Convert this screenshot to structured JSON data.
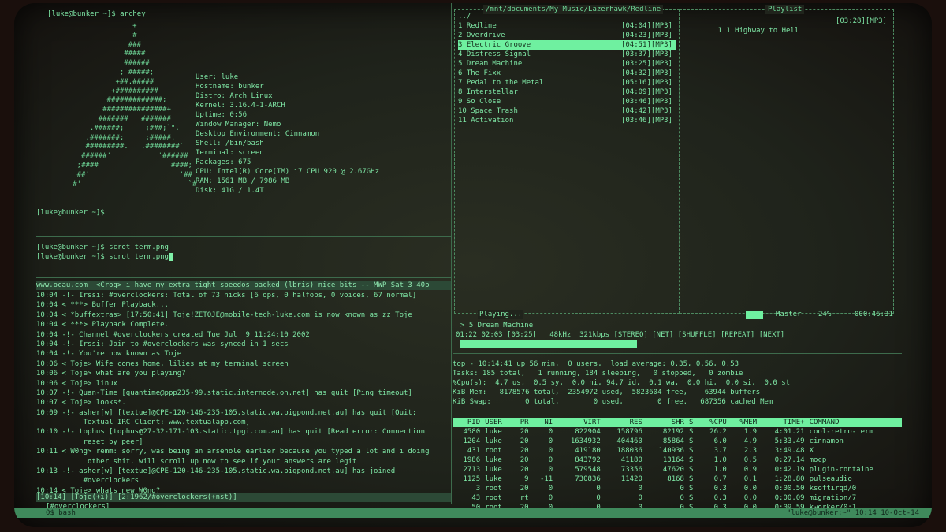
{
  "archey": {
    "prompt1": "[luke@bunker ~]$ archey",
    "logo_lines": [
      "                 +",
      "                 #",
      "                ###",
      "               #####",
      "               ######",
      "              ; #####;",
      "             +##.#####",
      "            +##########",
      "           #############;",
      "          ###############+",
      "         #######   #######",
      "       .######;     ;###;`\".",
      "      .#######;     ;#####.",
      "      #########.   .########`",
      "     ######'           '######",
      "    ;####                 ####;",
      "    ##'                     '##",
      "   #'                         `#"
    ],
    "info": [
      "User: luke",
      "Hostname: bunker",
      "Distro: Arch Linux",
      "Kernel: 3.16.4-1-ARCH",
      "Uptime: 0:56",
      "Window Manager: Nemo",
      "Desktop Environment: Cinnamon",
      "Shell: /bin/bash",
      "Terminal: screen",
      "Packages: 675",
      "CPU: Intel(R) Core(TM) i7 CPU 920 @ 2.67GHz",
      "RAM: 1561 MB / 7986 MB",
      "Disk: 41G / 1.4T"
    ],
    "prompt2": "[luke@bunker ~]$"
  },
  "scrot": {
    "line1": "[luke@bunker ~]$ scrot term.png",
    "line2": "[luke@bunker ~]$ scrot term.png"
  },
  "player": {
    "dir_title": "/mnt/documents/My Music/Lazerhawk/Redline",
    "parent": "../",
    "tracks": [
      {
        "name": "1 Redline",
        "dur": "[04:04][MP3]"
      },
      {
        "name": "2 Overdrive",
        "dur": "[04:23][MP3]"
      },
      {
        "name": "3 Electric Groove",
        "dur": "[04:51][MP3]"
      },
      {
        "name": "4 Distress Signal",
        "dur": "[03:37][MP3]"
      },
      {
        "name": "5 Dream Machine",
        "dur": "[03:25][MP3]"
      },
      {
        "name": "6 The Fixx",
        "dur": "[04:32][MP3]"
      },
      {
        "name": "7 Pedal to the Metal",
        "dur": "[05:16][MP3]"
      },
      {
        "name": "8 Interstellar",
        "dur": "[04:09][MP3]"
      },
      {
        "name": "9 So Close",
        "dur": "[03:46][MP3]"
      },
      {
        "name": "10 Space Trash",
        "dur": "[04:42][MP3]"
      },
      {
        "name": "11 Activation",
        "dur": "[03:46][MP3]"
      }
    ],
    "selected_index": 2,
    "playlist_title": "Playlist",
    "playlist_item": "1 1 Highway to Hell",
    "playlist_dur": "[03:28][MP3]",
    "playing_label": "Playing...",
    "now_playing": "> 5 Dream Machine",
    "status_line": "01:22 02:03 [03:25]   48kHz  321kbps [STEREO] [NET] [SHUFFLE] [REPEAT] [NEXT]",
    "progress": 0.4,
    "master_label": "Master",
    "volume": "24%",
    "total_time": "000:46:31"
  },
  "irc": {
    "topic": "www.ocau.com  <Crog> i have my extra tight speedos packed (lbris) nice bits -- MWP Sat 3 40p",
    "lines": [
      "10:04 -!- Irssi: #overclockers: Total of 73 nicks [6 ops, 0 halfops, 0 voices, 67 normal]",
      "10:04 < ***> Buffer Playback...",
      "10:04 < *buffextras> [17:50:41] Toje!ZETOJE@mobile-tech-luke.com is now known as zz_Toje",
      "10:04 < ***> Playback Complete.",
      "10:04 -!- Channel #overclockers created Tue Jul  9 11:24:10 2002",
      "10:04 -!- Irssi: Join to #overclockers was synced in 1 secs",
      "10:04 -!- You're now known as Toje",
      "10:06 < Toje> Wife comes home, lilies at my terminal screen",
      "10:06 < Toje> what are you playing?",
      "10:06 < Toje> linux",
      "10:07 -!- Quan-Time [quantime@ppp235-99.static.internode.on.net] has quit [Ping timeout]",
      "10:07 < Toje> looks*.",
      "10:09 -!- asher[w] [textue]@CPE-120-146-235-105.static.wa.bigpond.net.au] has quit [Quit:",
      "           Textual IRC Client: www.textualapp.com]",
      "10:10 -!- tophus [tophus@27-32-171-103.static.tpgi.com.au] has quit [Read error: Connection",
      "           reset by peer]",
      "10:11 < W0ng> remm: sorry, was being an arsehole earlier because you typed a lot and i doing",
      "            other shit. will scroll up now to see if your answers are legit",
      "10:13 -!- asher[w] [textue]@CPE-120-146-235-105.static.wa.bigpond.net.au] has joined",
      "           #overclockers",
      "10:14 < Toje> whats new W0ng?"
    ],
    "status1": "[10:14] [Toje(+i)] [2:1962/#overclockers(+nst)]",
    "channel": "[#overclockers]",
    "tab_bar": "0$ bash",
    "bottom_right": "\"luke@bunker:~\" 10:14 10-Oct-14"
  },
  "htop": {
    "summary": [
      "top - 10:14:41 up 56 min,  0 users,  load average: 0.35, 0.56, 0.53",
      "Tasks: 185 total,   1 running, 184 sleeping,   0 stopped,   0 zombie",
      "%Cpu(s):  4.7 us,  0.5 sy,  0.0 ni, 94.7 id,  0.1 wa,  0.0 hi,  0.0 si,  0.0 st",
      "KiB Mem:   8178576 total,  2354972 used,  5823604 free,    63944 buffers",
      "KiB Swap:        0 total,        0 used,        0 free.   687356 cached Mem"
    ],
    "columns": [
      "PID",
      "USER",
      "PR",
      "NI",
      "VIRT",
      "RES",
      "SHR",
      "S",
      "%CPU",
      "%MEM",
      "TIME+",
      "COMMAND"
    ],
    "rows": [
      [
        "4580",
        "luke",
        "20",
        "0",
        "822904",
        "158796",
        "82192",
        "S",
        "26.2",
        "1.9",
        "4:01.21",
        "cool-retro-term"
      ],
      [
        "1204",
        "luke",
        "20",
        "0",
        "1634932",
        "404460",
        "85864",
        "S",
        "6.0",
        "4.9",
        "5:33.49",
        "cinnamon"
      ],
      [
        "431",
        "root",
        "20",
        "0",
        "419180",
        "188036",
        "140936",
        "S",
        "3.7",
        "2.3",
        "3:49.48",
        "X"
      ],
      [
        "1986",
        "luke",
        "20",
        "0",
        "843792",
        "41180",
        "13164",
        "S",
        "1.0",
        "0.5",
        "0:27.14",
        "mocp"
      ],
      [
        "2713",
        "luke",
        "20",
        "0",
        "579548",
        "73356",
        "47620",
        "S",
        "1.0",
        "0.9",
        "0:42.19",
        "plugin-containe"
      ],
      [
        "1125",
        "luke",
        "9",
        "-11",
        "730836",
        "11420",
        "8168",
        "S",
        "0.7",
        "0.1",
        "1:28.80",
        "pulseaudio"
      ],
      [
        "3",
        "root",
        "20",
        "0",
        "0",
        "0",
        "0",
        "S",
        "0.3",
        "0.0",
        "0:00.50",
        "ksoftirqd/0"
      ],
      [
        "43",
        "root",
        "rt",
        "0",
        "0",
        "0",
        "0",
        "S",
        "0.3",
        "0.0",
        "0:00.09",
        "migration/7"
      ],
      [
        "50",
        "root",
        "20",
        "0",
        "0",
        "0",
        "0",
        "S",
        "0.3",
        "0.0",
        "0:09.59",
        "kworker/0:1"
      ]
    ]
  }
}
